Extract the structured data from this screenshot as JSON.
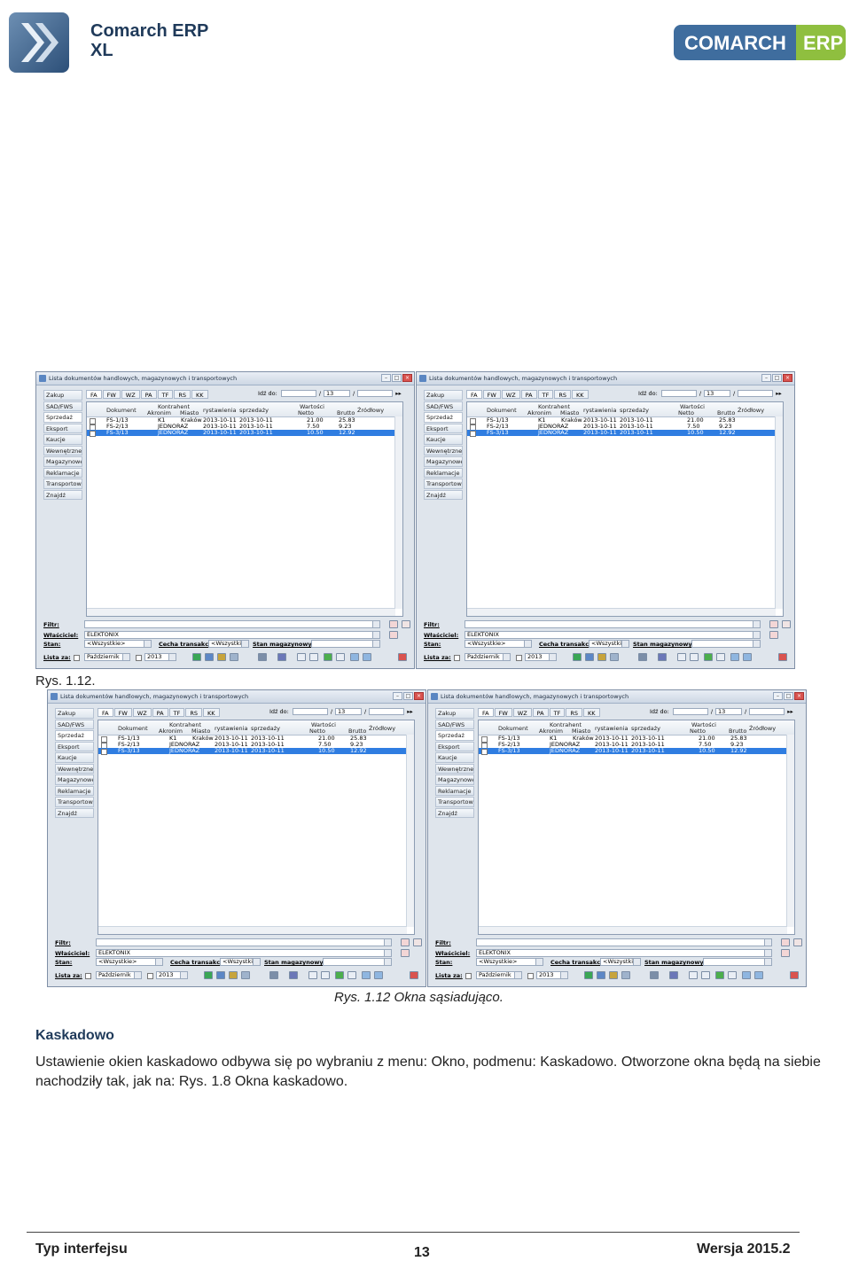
{
  "header": {
    "brand_line1": "Comarch ERP",
    "brand_line2": "XL",
    "right_logo_word1": "COMARCH",
    "right_logo_word2": "ERP"
  },
  "window": {
    "title": "Lista dokumentów handlowych, magazynowych i transportowych",
    "sidebar": [
      "Zakup",
      "SAD/FWS",
      "Sprzedaż",
      "Eksport",
      "Kaucje",
      "Wewnętrzne",
      "Magazynowe",
      "Reklamacje",
      "Transportowe",
      "Znajdź"
    ],
    "tabs": [
      "FA",
      "FW",
      "WZ",
      "PA",
      "TF",
      "RS",
      "KK"
    ],
    "goto_label": "Idź do:",
    "goto_page": "13",
    "columns": {
      "dokument": "Dokument",
      "kontrahent": "Kontrahent",
      "akronim": "Akronim",
      "miasto": "Miasto",
      "daty": "rystawienia",
      "sprzedazy": "sprzedaży",
      "wartosci": "Wartości",
      "netto": "Netto",
      "brutto": "Brutto",
      "zrodlowy": "Źródłowy"
    },
    "rows": [
      {
        "doc": "FS-1/13",
        "akronim": "K1",
        "miasto": "Kraków",
        "d1": "2013-10-11",
        "d2": "2013-10-11",
        "netto": "21.00",
        "brutto": "25.83"
      },
      {
        "doc": "FS-2/13",
        "akronim": "JEDNORAZ",
        "miasto": "",
        "d1": "2013-10-11",
        "d2": "2013-10-11",
        "netto": "7.50",
        "brutto": "9.23"
      },
      {
        "doc": "FS-3/13",
        "akronim": "JEDNORAZ",
        "miasto": "",
        "d1": "2013-10-11",
        "d2": "2013-10-11",
        "netto": "10.50",
        "brutto": "12.92"
      }
    ],
    "filtr_label": "Filtr:",
    "wlasciciel_label": "Właściciel:",
    "wlasciciel_value": "ELEKTONIX",
    "stan_label": "Stan:",
    "stan_value": "<Wszystkie>",
    "cecha_label": "Cecha transakcji:",
    "cecha_value": "<Wszystkie>",
    "stan_mag_label": "Stan magazynowych:",
    "lista_za_label": "Lista za:",
    "miesiac_value": "Październik",
    "rok_value": "2013"
  },
  "captions": {
    "fig_top": "Rys. 1.12.",
    "fig_bottom": "Rys. 1.12 Okna sąsiadująco."
  },
  "section": {
    "heading": "Kaskadowo",
    "paragraph": "Ustawienie okien kaskadowo odbywa się po wybraniu z menu: Okno, podmenu: Kaskadowo. Otworzone okna będą na siebie nachodziły tak, jak na: Rys. 1.8 Okna kaskadowo."
  },
  "footer": {
    "left": "Typ interfejsu",
    "page": "13",
    "right": "Wersja 2015.2"
  }
}
